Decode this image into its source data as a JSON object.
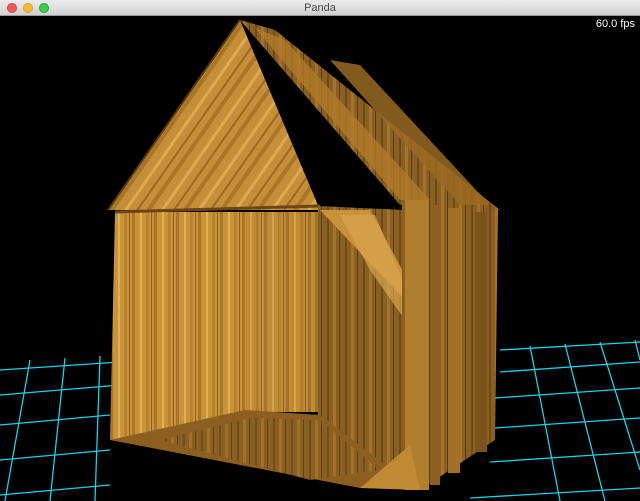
{
  "window": {
    "title": "Panda"
  },
  "hud": {
    "fps": "60.0 fps"
  },
  "colors": {
    "grid": "#19d3ea",
    "background": "#000000",
    "wood_light": "#d7a444",
    "wood_mid": "#c08a35",
    "wood_dark": "#7a5520"
  },
  "icons": {
    "close": "close-icon",
    "minimize": "minimize-icon",
    "zoom": "zoom-icon"
  }
}
